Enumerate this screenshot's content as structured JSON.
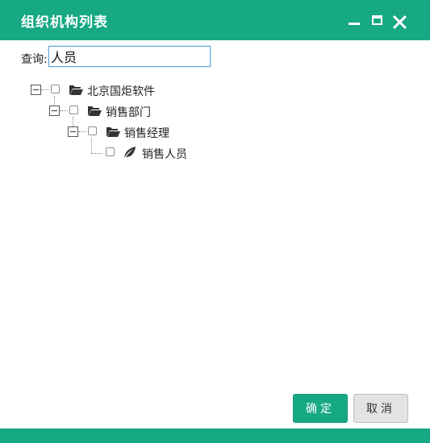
{
  "window": {
    "title": "组织机构列表",
    "accent": "#17a884",
    "controls": [
      "minimize-icon",
      "maximize-icon",
      "close-icon"
    ]
  },
  "search": {
    "label": "查询:",
    "value": "人员"
  },
  "tree": {
    "nodes": [
      {
        "label": "北京国炬软件",
        "level": 0,
        "icon": "folder-open-icon",
        "expanded": true,
        "checked": false
      },
      {
        "label": "销售部门",
        "level": 1,
        "icon": "folder-open-icon",
        "expanded": true,
        "checked": false
      },
      {
        "label": "销售经理",
        "level": 2,
        "icon": "folder-open-icon",
        "expanded": true,
        "checked": false
      },
      {
        "label": "销售人员",
        "level": 3,
        "icon": "leaf-icon",
        "expanded": false,
        "checked": false
      }
    ]
  },
  "footer": {
    "ok_label": "确定",
    "cancel_label": "取消"
  }
}
